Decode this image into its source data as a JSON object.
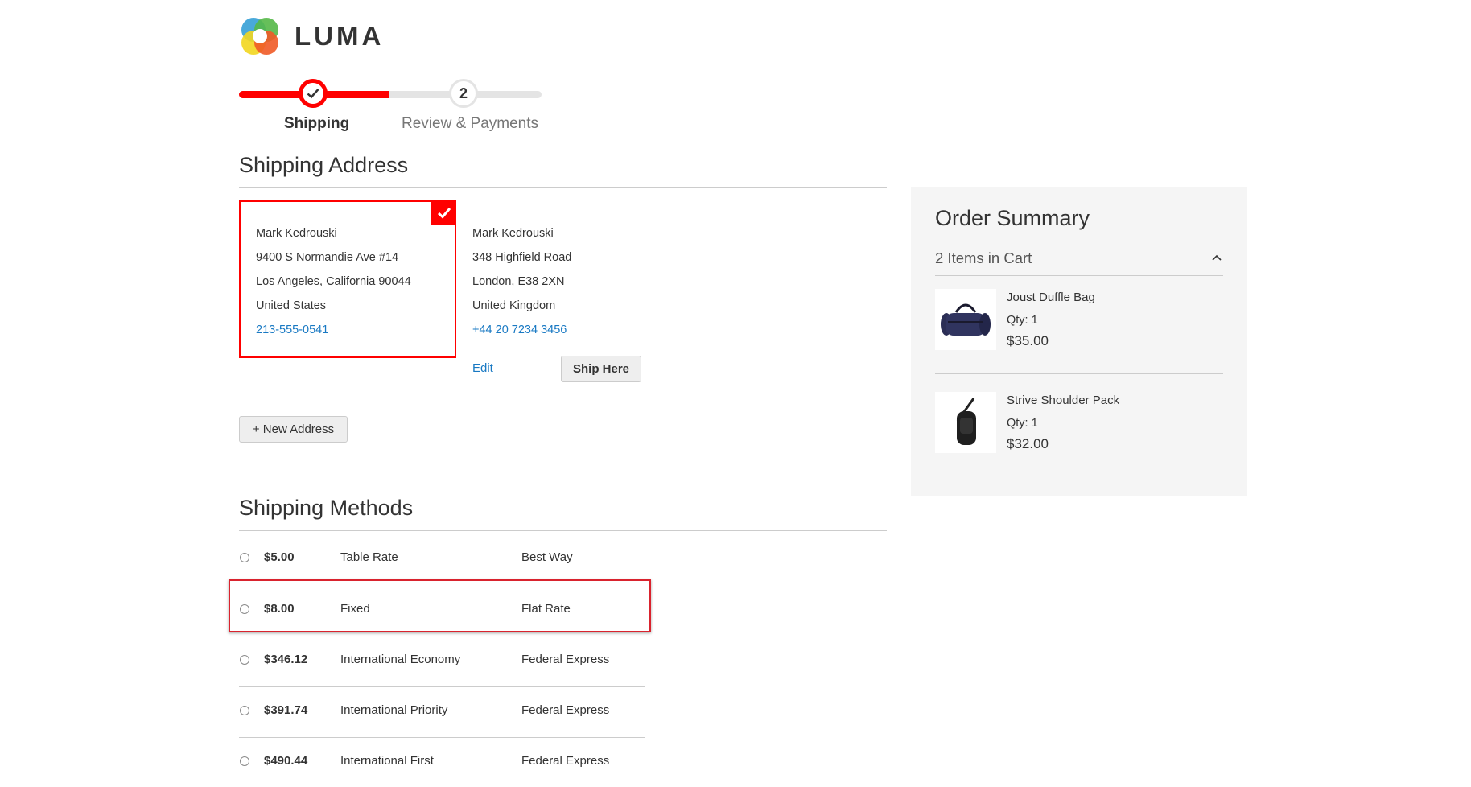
{
  "brand": {
    "name": "LUMA"
  },
  "progress": {
    "steps": [
      {
        "number": "",
        "label": "Shipping"
      },
      {
        "number": "2",
        "label": "Review & Payments"
      }
    ]
  },
  "shipping_address": {
    "title": "Shipping Address",
    "addresses": [
      {
        "name": "Mark Kedrouski",
        "street": "9400 S Normandie Ave #14",
        "city_line": "Los Angeles, California 90044",
        "country": "United States",
        "phone": "213-555-0541",
        "selected": true
      },
      {
        "name": "Mark Kedrouski",
        "street": "348 Highfield Road",
        "city_line": "London, E38 2XN",
        "country": "United Kingdom",
        "phone": "+44 20 7234 3456",
        "selected": false
      }
    ],
    "edit_label": "Edit",
    "ship_here_label": "Ship Here",
    "new_address_label": "+ New Address"
  },
  "shipping_methods": {
    "title": "Shipping Methods",
    "methods": [
      {
        "price": "$5.00",
        "method": "Table Rate",
        "carrier": "Best Way"
      },
      {
        "price": "$8.00",
        "method": "Fixed",
        "carrier": "Flat Rate"
      },
      {
        "price": "$346.12",
        "method": "International Economy",
        "carrier": "Federal Express"
      },
      {
        "price": "$391.74",
        "method": "International Priority",
        "carrier": "Federal Express"
      },
      {
        "price": "$490.44",
        "method": "International First",
        "carrier": "Federal Express"
      }
    ]
  },
  "order_summary": {
    "title": "Order Summary",
    "cart_count_label": "2 Items in Cart",
    "items": [
      {
        "name": "Joust Duffle Bag",
        "qty": "Qty: 1",
        "price": "$35.00",
        "icon": "duffle-bag-icon"
      },
      {
        "name": "Strive Shoulder Pack",
        "qty": "Qty: 1",
        "price": "$32.00",
        "icon": "shoulder-pack-icon"
      }
    ]
  },
  "colors": {
    "accent": "#ff0000",
    "link": "#1979c3",
    "highlight": "#d9232e"
  }
}
